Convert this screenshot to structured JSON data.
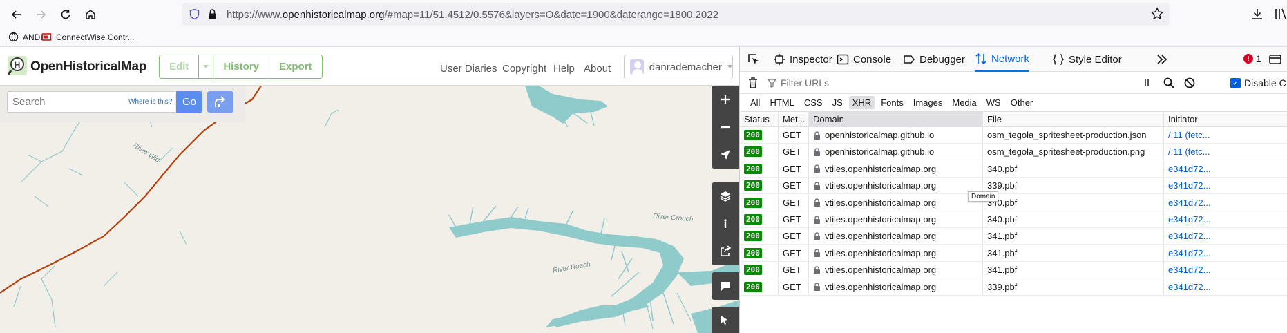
{
  "browser": {
    "url_prefix": "https://www.",
    "url_host": "openhistoricalmap.org",
    "url_path": "/#map=11/51.4512/0.5576&layers=O&date=1900&daterange=1800,2022",
    "bookmarks": [
      "ANDI",
      "ConnectWise Contr..."
    ]
  },
  "ohm": {
    "site_title": "OpenHistoricalMap",
    "edit_label": "Edit",
    "history_label": "History",
    "export_label": "Export",
    "nav_links": [
      "User Diaries",
      "Copyright",
      "Help",
      "About"
    ],
    "username": "danrademacher",
    "search": {
      "placeholder": "Search",
      "where_link": "Where is this?",
      "go_label": "Go"
    },
    "map_labels": [
      "River Wid",
      "River Crouch",
      "River Roach"
    ],
    "colors": {
      "brand_green": "#7ebc6f",
      "go_blue": "#5b8def",
      "water": "#8fcbcb",
      "road": "#b5410f",
      "land": "#f2efe9"
    }
  },
  "devtools": {
    "tabs": [
      "Inspector",
      "Console",
      "Debugger",
      "Network",
      "Style Editor"
    ],
    "active_tab": "Network",
    "error_count": "1",
    "filter_placeholder": "Filter URLs",
    "disable_cache_label": "Disable C",
    "type_filters": [
      "All",
      "HTML",
      "CSS",
      "JS",
      "XHR",
      "Fonts",
      "Images",
      "Media",
      "WS",
      "Other"
    ],
    "active_type": "XHR",
    "columns": [
      "Status",
      "Met...",
      "Domain",
      "File",
      "Initiator"
    ],
    "tooltip": "Domain",
    "rows": [
      {
        "status": "200",
        "method": "GET",
        "domain": "openhistoricalmap.github.io",
        "file": "osm_tegola_spritesheet-production.json",
        "initiator": "/:11 (fetc..."
      },
      {
        "status": "200",
        "method": "GET",
        "domain": "openhistoricalmap.github.io",
        "file": "osm_tegola_spritesheet-production.png",
        "initiator": "/:11 (fetc..."
      },
      {
        "status": "200",
        "method": "GET",
        "domain": "vtiles.openhistoricalmap.org",
        "file": "340.pbf",
        "initiator": "e341d72..."
      },
      {
        "status": "200",
        "method": "GET",
        "domain": "vtiles.openhistoricalmap.org",
        "file": "339.pbf",
        "initiator": "e341d72..."
      },
      {
        "status": "200",
        "method": "GET",
        "domain": "vtiles.openhistoricalmap.org",
        "file": "340.pbf",
        "initiator": "e341d72..."
      },
      {
        "status": "200",
        "method": "GET",
        "domain": "vtiles.openhistoricalmap.org",
        "file": "340.pbf",
        "initiator": "e341d72..."
      },
      {
        "status": "200",
        "method": "GET",
        "domain": "vtiles.openhistoricalmap.org",
        "file": "341.pbf",
        "initiator": "e341d72..."
      },
      {
        "status": "200",
        "method": "GET",
        "domain": "vtiles.openhistoricalmap.org",
        "file": "341.pbf",
        "initiator": "e341d72..."
      },
      {
        "status": "200",
        "method": "GET",
        "domain": "vtiles.openhistoricalmap.org",
        "file": "341.pbf",
        "initiator": "e341d72..."
      },
      {
        "status": "200",
        "method": "GET",
        "domain": "vtiles.openhistoricalmap.org",
        "file": "339.pbf",
        "initiator": "e341d72..."
      }
    ]
  }
}
